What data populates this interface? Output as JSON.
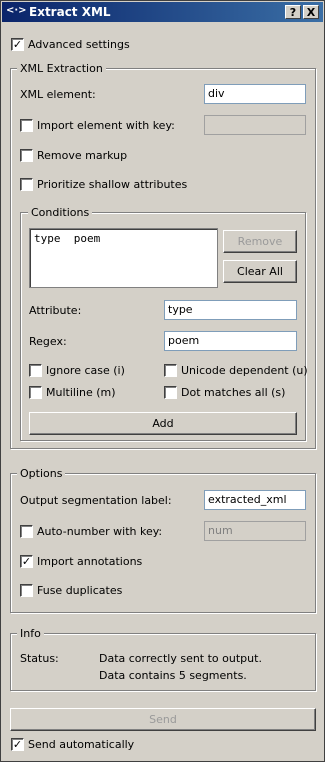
{
  "window": {
    "title": "Extract XML",
    "help_button": "?",
    "close_button": "X"
  },
  "advanced_settings": {
    "label": "Advanced settings",
    "checked": true
  },
  "xml_extraction": {
    "legend": "XML Extraction",
    "xml_element_label": "XML element:",
    "xml_element_value": "div",
    "import_key_label": "Import element with key:",
    "import_key_value": "",
    "remove_markup_label": "Remove markup",
    "prioritize_label": "Prioritize shallow attributes"
  },
  "conditions": {
    "legend": "Conditions",
    "items": [
      {
        "attribute": "type",
        "regex": "poem"
      }
    ],
    "remove_button": "Remove",
    "clear_all_button": "Clear All",
    "attribute_label": "Attribute:",
    "attribute_value": "type",
    "regex_label": "Regex:",
    "regex_value": "poem",
    "ignore_case_label": "Ignore case (i)",
    "unicode_label": "Unicode dependent (u)",
    "multiline_label": "Multiline (m)",
    "dotall_label": "Dot matches all (s)",
    "add_button": "Add"
  },
  "options": {
    "legend": "Options",
    "output_label": "Output segmentation label:",
    "output_value": "extracted_xml",
    "autonumber_label": "Auto-number with key:",
    "autonumber_value": "num",
    "import_annotations_label": "Import annotations",
    "import_annotations_checked": true,
    "fuse_duplicates_label": "Fuse duplicates"
  },
  "info": {
    "legend": "Info",
    "status_label": "Status:",
    "status_line1": "Data correctly sent to output.",
    "status_line2": "Data contains 5 segments."
  },
  "send": {
    "button": "Send",
    "auto_label": "Send automatically",
    "auto_checked": true
  }
}
